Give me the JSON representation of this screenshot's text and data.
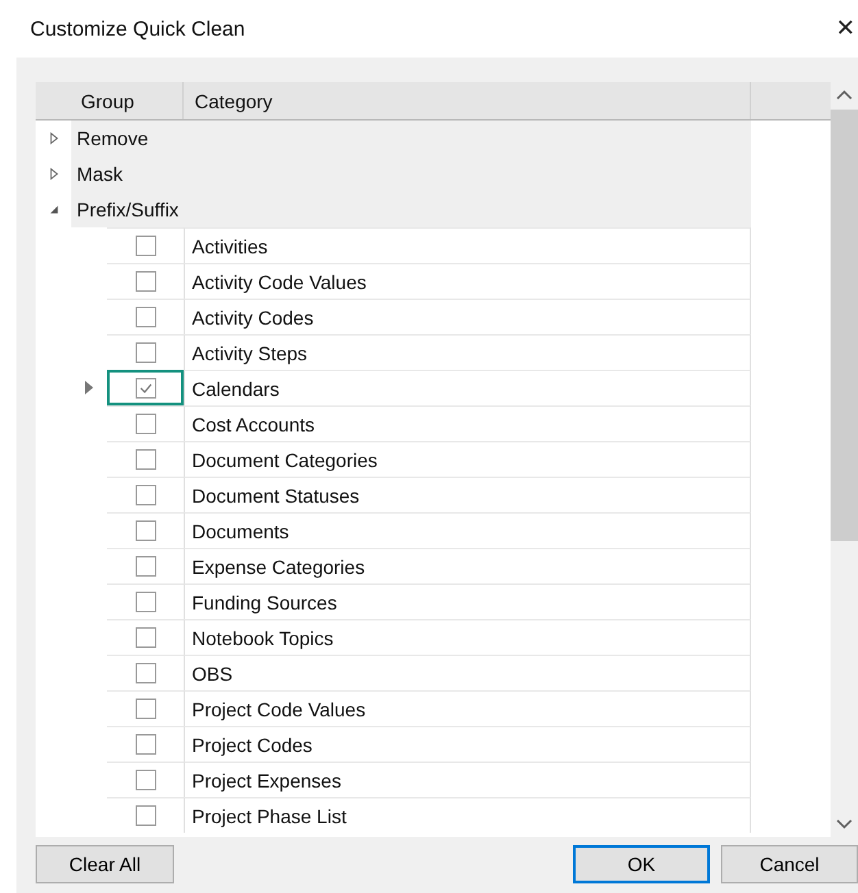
{
  "window": {
    "title": "Customize Quick Clean",
    "close": "✕"
  },
  "table": {
    "columns": [
      "Group",
      "Category"
    ],
    "groups": [
      {
        "label": "Remove",
        "expanded": false
      },
      {
        "label": "Mask",
        "expanded": false
      },
      {
        "label": "Prefix/Suffix",
        "expanded": true,
        "children": [
          {
            "label": "Activities",
            "checked": false,
            "selected": false
          },
          {
            "label": "Activity Code Values",
            "checked": false,
            "selected": false
          },
          {
            "label": "Activity Codes",
            "checked": false,
            "selected": false
          },
          {
            "label": "Activity Steps",
            "checked": false,
            "selected": false
          },
          {
            "label": "Calendars",
            "checked": true,
            "selected": true
          },
          {
            "label": "Cost Accounts",
            "checked": false,
            "selected": false
          },
          {
            "label": "Document Categories",
            "checked": false,
            "selected": false
          },
          {
            "label": "Document Statuses",
            "checked": false,
            "selected": false
          },
          {
            "label": "Documents",
            "checked": false,
            "selected": false
          },
          {
            "label": "Expense Categories",
            "checked": false,
            "selected": false
          },
          {
            "label": "Funding Sources",
            "checked": false,
            "selected": false
          },
          {
            "label": "Notebook Topics",
            "checked": false,
            "selected": false
          },
          {
            "label": "OBS",
            "checked": false,
            "selected": false
          },
          {
            "label": "Project Code Values",
            "checked": false,
            "selected": false
          },
          {
            "label": "Project Codes",
            "checked": false,
            "selected": false
          },
          {
            "label": "Project Expenses",
            "checked": false,
            "selected": false
          },
          {
            "label": "Project Phase List",
            "checked": false,
            "selected": false
          }
        ]
      }
    ]
  },
  "buttons": [
    {
      "label": "Clear All",
      "default": false,
      "kind": "start"
    },
    {
      "label": "OK",
      "default": true,
      "kind": "end"
    },
    {
      "label": "Cancel",
      "default": false,
      "kind": "end"
    }
  ]
}
